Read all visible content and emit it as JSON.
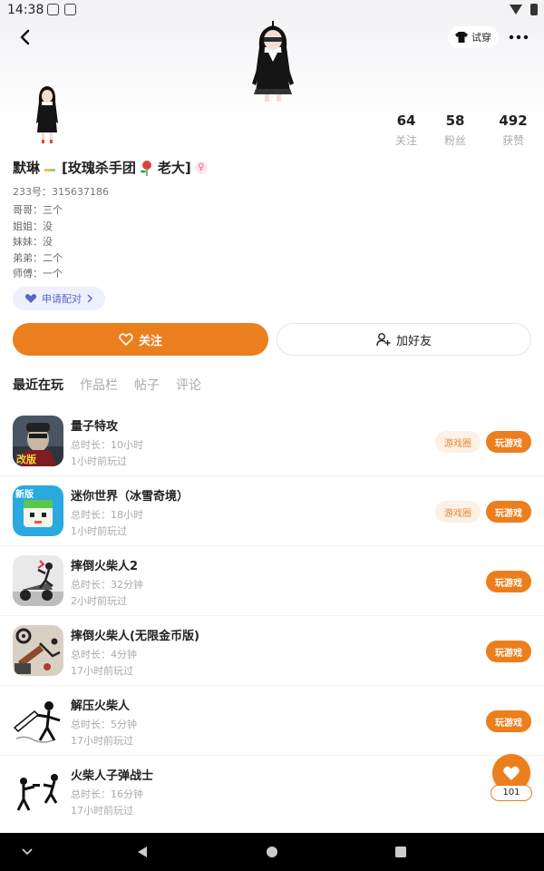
{
  "status_bar": {
    "time": "14:38"
  },
  "header": {
    "tryon_label": "试穿"
  },
  "profile": {
    "stats": [
      {
        "value": "64",
        "label": "关注"
      },
      {
        "value": "58",
        "label": "粉丝"
      },
      {
        "value": "492",
        "label": "获赞"
      }
    ],
    "username_pre": "默琳",
    "username_post": "[玫瑰杀手团",
    "username_end": "老大]",
    "uid": "233号：315637186",
    "bio": [
      "哥哥：三个",
      "姐姐：没",
      "妹妹：没",
      "弟弟：二个",
      "师傅：一个"
    ],
    "pair_label": "申请配对"
  },
  "actions": {
    "follow_label": "关注",
    "add_friend_label": "加好友"
  },
  "tabs": [
    "最近在玩",
    "作品栏",
    "帖子",
    "评论"
  ],
  "games": [
    {
      "name": "量子特攻",
      "duration": "总时长：10小时",
      "last_played": "1小时前玩过",
      "circle": "游戏圈",
      "play": "玩游戏",
      "icon_label": "改版"
    },
    {
      "name": "迷你世界（冰雪奇境）",
      "duration": "总时长：18小时",
      "last_played": "1小时前玩过",
      "circle": "游戏圈",
      "play": "玩游戏",
      "icon_label": "新版"
    },
    {
      "name": "摔倒火柴人2",
      "duration": "总时长：32分钟",
      "last_played": "2小时前玩过",
      "play": "玩游戏"
    },
    {
      "name": "摔倒火柴人(无限金币版)",
      "duration": "总时长：4分钟",
      "last_played": "17小时前玩过",
      "play": "玩游戏"
    },
    {
      "name": "解压火柴人",
      "duration": "总时长：5分钟",
      "last_played": "17小时前玩过",
      "play": "玩游戏"
    },
    {
      "name": "火柴人子弹战士",
      "duration": "总时长：16分钟",
      "last_played": "17小时前玩过"
    }
  ],
  "fab": {
    "like_count": "101"
  },
  "colors": {
    "accent": "#eb7f1d",
    "pair": "#5a66c8"
  }
}
